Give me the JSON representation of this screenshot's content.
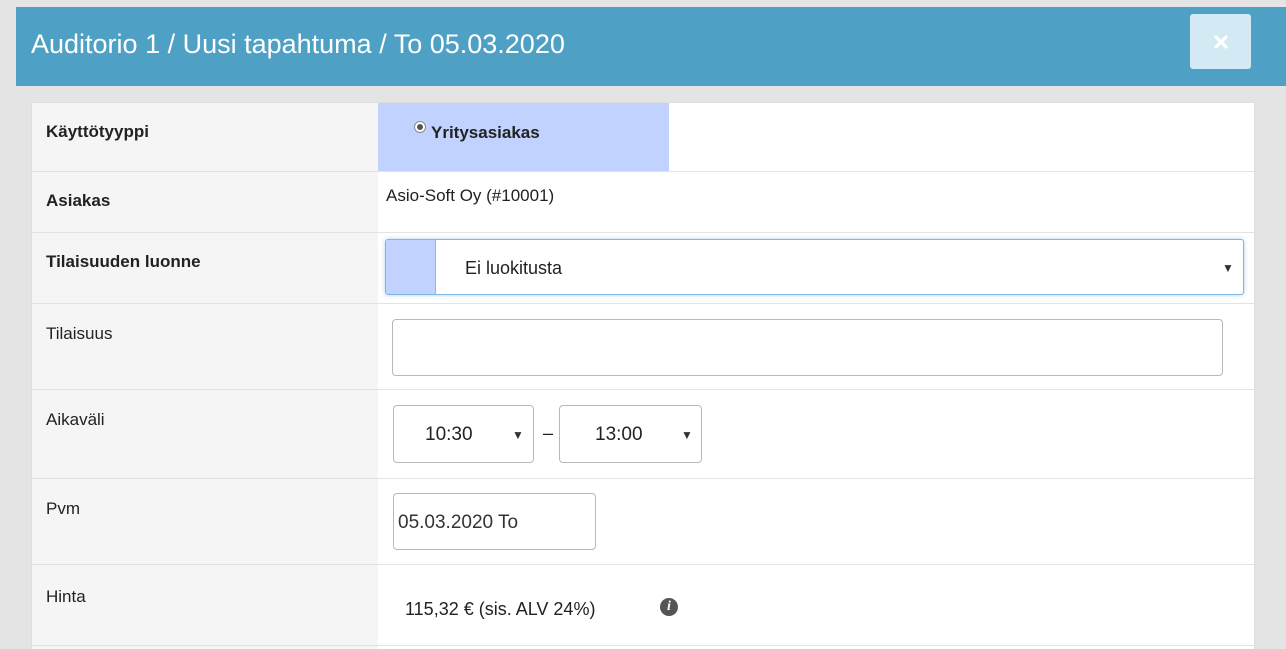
{
  "header": {
    "title": "Auditorio 1 / Uusi tapahtuma / To 05.03.2020",
    "close_icon": "close-icon",
    "colors": {
      "header_bg": "#4ea1c4",
      "close_button_bg": "#d3eaf4",
      "highlight": "#c1d2ff"
    }
  },
  "form": {
    "usage_type": {
      "label": "Käyttötyyppi",
      "option": "Yritysasiakas",
      "selected": true
    },
    "customer": {
      "label": "Asiakas",
      "value": "Asio-Soft Oy (#10001)"
    },
    "event_nature": {
      "label": "Tilaisuuden luonne",
      "selected": "Ei luokitusta"
    },
    "event": {
      "label": "Tilaisuus",
      "value": ""
    },
    "time_range": {
      "label": "Aikaväli",
      "start": "10:30",
      "separator": "–",
      "end": "13:00"
    },
    "date": {
      "label": "Pvm",
      "value": "05.03.2020 To"
    },
    "price": {
      "label": "Hinta",
      "value": "115,32 € (sis. ALV 24%)",
      "info_icon": "info-icon"
    }
  }
}
